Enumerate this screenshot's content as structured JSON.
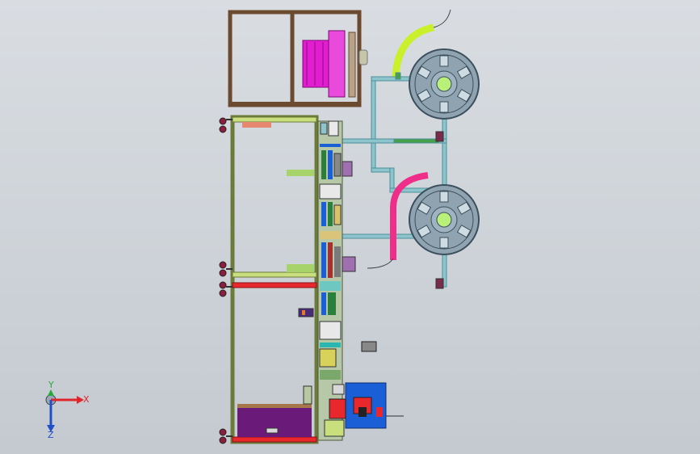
{
  "viewport": {
    "background_top": "#d9dde2",
    "background_bottom": "#c4cad0"
  },
  "colors": {
    "frame_dark_brown": "#6b4a2f",
    "frame_olive": "#6c7a3a",
    "frame_light_green": "#c9df7e",
    "light_blue_frame": "#8ec4cc",
    "reel_grey": "#6f8290",
    "magenta_spool": "#e21ed0",
    "yellow_green_tube": "#c9f02a",
    "pink_tube": "#ef2e8a",
    "red_bar": "#e8282d",
    "purple_panel": "#6a1b79",
    "blue_block": "#1b5fd6",
    "salmon": "#e6876f",
    "axis_x": "#e0262b",
    "axis_y": "#28a83a",
    "axis_z": "#2050c8"
  },
  "triad": {
    "x_label": "X",
    "y_label": "Y",
    "z_label": "Z"
  }
}
